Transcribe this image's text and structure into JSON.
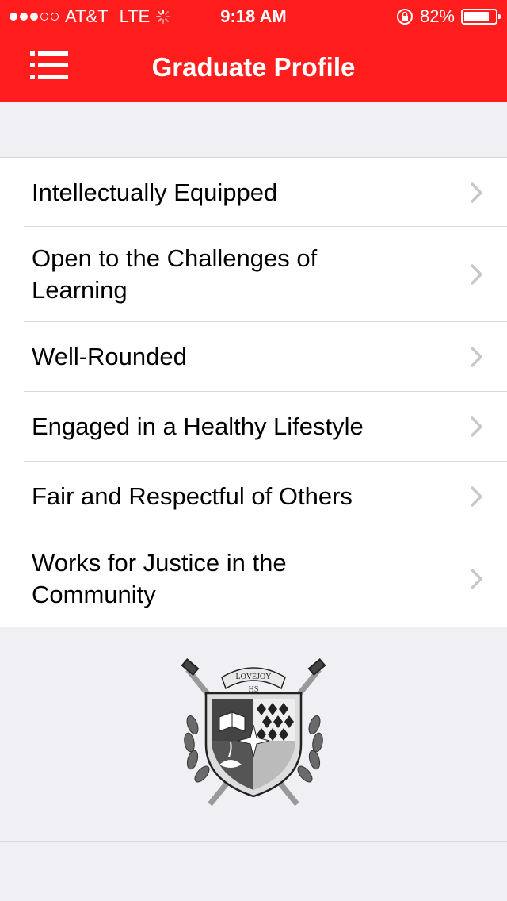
{
  "status_bar": {
    "carrier": "AT&T",
    "network": "LTE",
    "time": "9:18 AM",
    "battery_percent": "82%",
    "battery_level": 0.82,
    "signal_dots_filled": 3,
    "signal_dots_total": 5
  },
  "nav": {
    "title": "Graduate Profile",
    "menu_icon": "hamburger-list-icon"
  },
  "list": {
    "items": [
      {
        "label": "Intellectually Equipped"
      },
      {
        "label": "Open to the Challenges of Learning"
      },
      {
        "label": "Well-Rounded"
      },
      {
        "label": "Engaged in a Healthy Lifestyle"
      },
      {
        "label": "Fair and Respectful of Others"
      },
      {
        "label": "Works for Justice in the Community"
      }
    ],
    "chevron_icon": "chevron-right-icon"
  },
  "crest": {
    "banner_text": "LOVEJOY",
    "initials": "HS"
  },
  "colors": {
    "brand": "#ff1d1d",
    "background": "#efeff4",
    "separator": "#d8d8dc",
    "chevron": "#c7c7cc"
  }
}
